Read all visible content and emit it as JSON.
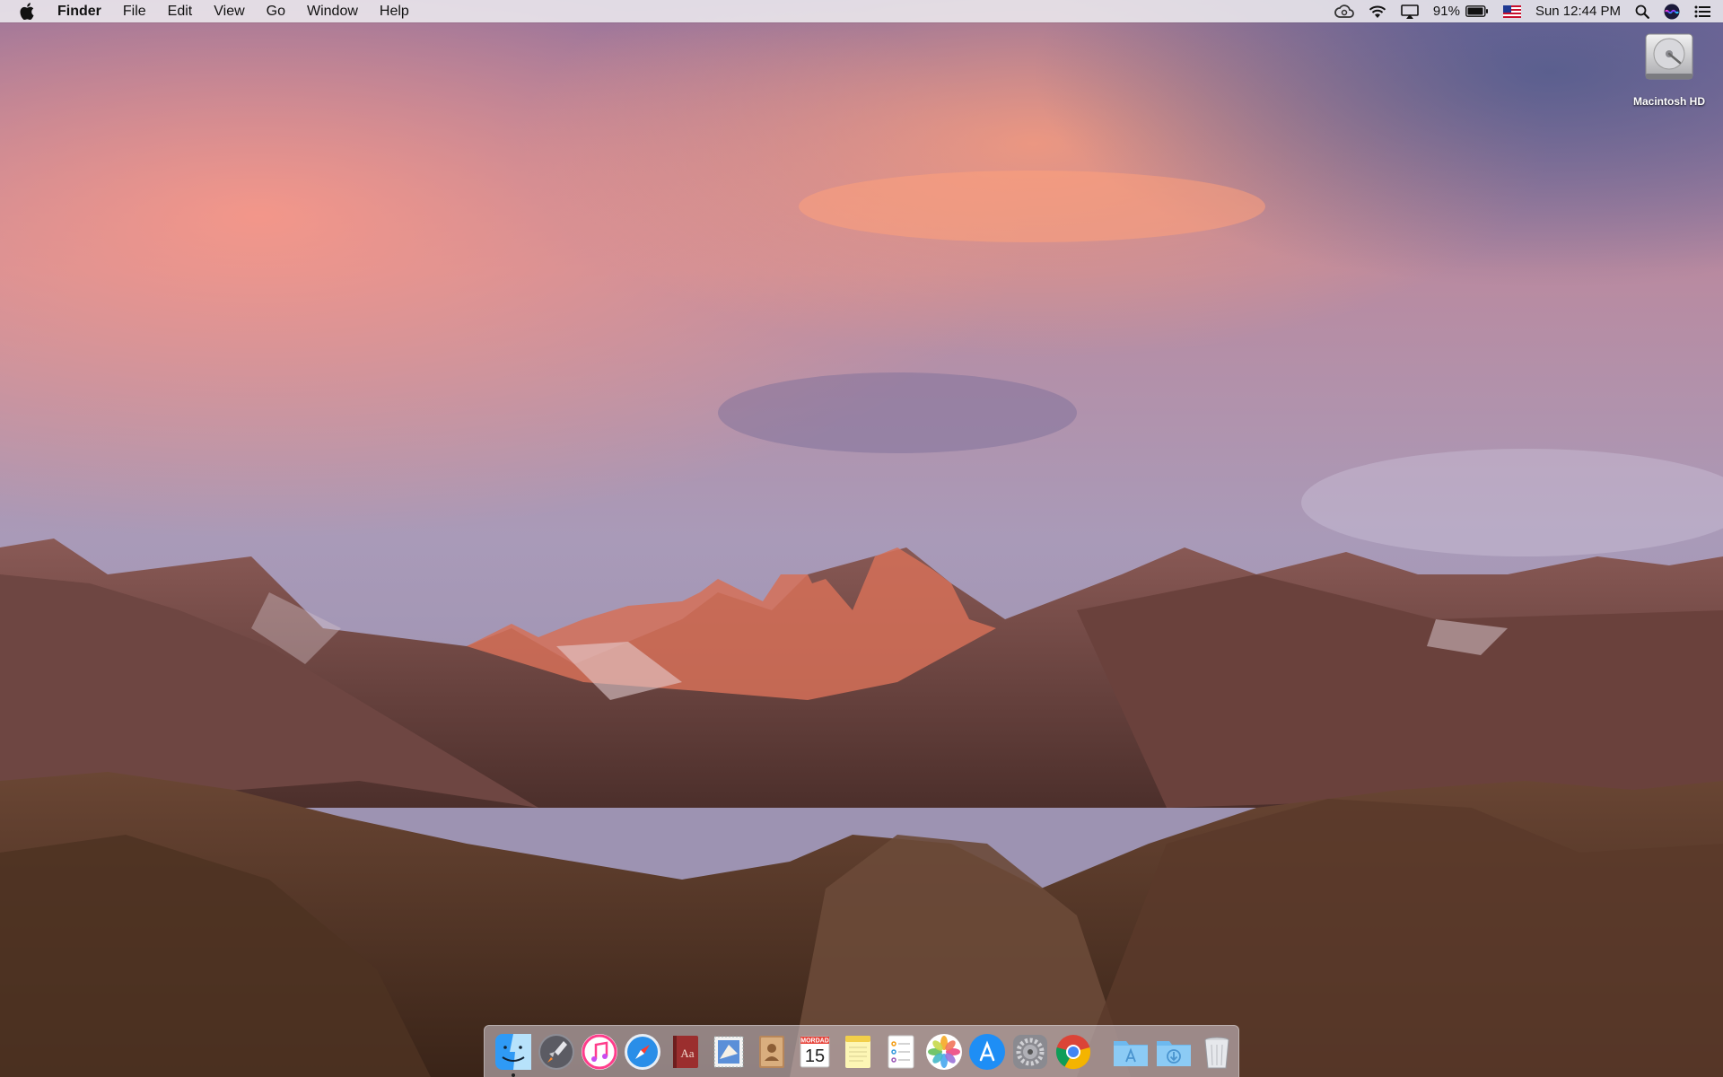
{
  "menubar": {
    "app_name": "Finder",
    "menus": [
      "File",
      "Edit",
      "View",
      "Go",
      "Window",
      "Help"
    ],
    "battery_percent": "91%",
    "clock": "Sun 12:44 PM"
  },
  "desktop": {
    "icons": [
      {
        "label": "Macintosh HD",
        "icon": "hard-drive-icon"
      }
    ]
  },
  "dock": {
    "apps": [
      {
        "name": "finder",
        "icon": "finder-icon",
        "running": true
      },
      {
        "name": "launchpad",
        "icon": "rocket-icon",
        "running": false
      },
      {
        "name": "itunes",
        "icon": "music-note-icon",
        "running": false
      },
      {
        "name": "safari",
        "icon": "compass-icon",
        "running": false
      },
      {
        "name": "dictionary",
        "icon": "dictionary-icon",
        "running": false
      },
      {
        "name": "mail",
        "icon": "stamp-icon",
        "running": false
      },
      {
        "name": "contacts",
        "icon": "address-book-icon",
        "running": false
      },
      {
        "name": "calendar",
        "icon": "calendar-icon",
        "running": false,
        "calendar_month": "MORDAD",
        "calendar_day": "15"
      },
      {
        "name": "notes",
        "icon": "notepad-icon",
        "running": false
      },
      {
        "name": "reminders",
        "icon": "checklist-icon",
        "running": false
      },
      {
        "name": "photos",
        "icon": "flower-icon",
        "running": false
      },
      {
        "name": "app-store",
        "icon": "app-store-icon",
        "running": false
      },
      {
        "name": "system-preferences",
        "icon": "gear-icon",
        "running": false
      },
      {
        "name": "chrome",
        "icon": "chrome-icon",
        "running": false
      }
    ],
    "stacks": [
      {
        "name": "applications-folder",
        "icon": "folder-apps-icon"
      },
      {
        "name": "downloads-folder",
        "icon": "folder-download-icon"
      },
      {
        "name": "trash",
        "icon": "trash-icon"
      }
    ]
  },
  "colors": {
    "menubar_bg": "#ece9ee",
    "accent_blue": "#1e8ef5"
  }
}
